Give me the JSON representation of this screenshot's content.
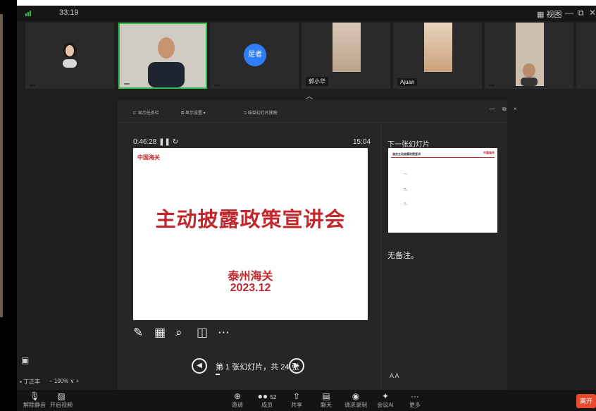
{
  "topbar": {
    "secure_badge": "",
    "timer": "33:19",
    "view_label": "视图"
  },
  "participants": [
    {
      "name": "",
      "type": "avatar"
    },
    {
      "name": "",
      "type": "video"
    },
    {
      "name": "",
      "type": "initials",
      "initials": "足者"
    },
    {
      "name": "郭小华",
      "type": "video"
    },
    {
      "name": "Ajuan",
      "type": "video"
    },
    {
      "name": "",
      "type": "video"
    }
  ],
  "presenter": {
    "toolbar": [
      "显示任务栏",
      "显示设置 ▾",
      "结束幻灯片放映"
    ],
    "elapsed": "0:46:28",
    "clock": "15:04",
    "slide": {
      "logo": "中国海关",
      "title": "主动披露政策宣讲会",
      "org": "泰州海关",
      "date": "2023.12"
    },
    "nav_label": "第 1 张幻灯片，共 24 张",
    "next_label": "下一张幻灯片",
    "next_slide": {
      "heading": "海关主动披露政策宣讲",
      "items": [
        "一、",
        "二、",
        "三、"
      ]
    },
    "notes": "无备注。",
    "font_controls": "A  A"
  },
  "side": {
    "name": "丁正丰",
    "zoom": "100%"
  },
  "bottombar": [
    {
      "label": "解除静音",
      "icon": "mic-icon"
    },
    {
      "label": "开启视频",
      "icon": "camera-icon"
    },
    {
      "label": "邀请",
      "icon": "invite-icon"
    },
    {
      "label": "成员",
      "icon": "members-icon",
      "count": "52"
    },
    {
      "label": "共享",
      "icon": "share-icon"
    },
    {
      "label": "聊天",
      "icon": "chat-icon"
    },
    {
      "label": "请求录制",
      "icon": "record-icon"
    },
    {
      "label": "会议AI",
      "icon": "ai-icon"
    },
    {
      "label": "更多",
      "icon": "more-icon"
    }
  ],
  "leave_label": "离开"
}
